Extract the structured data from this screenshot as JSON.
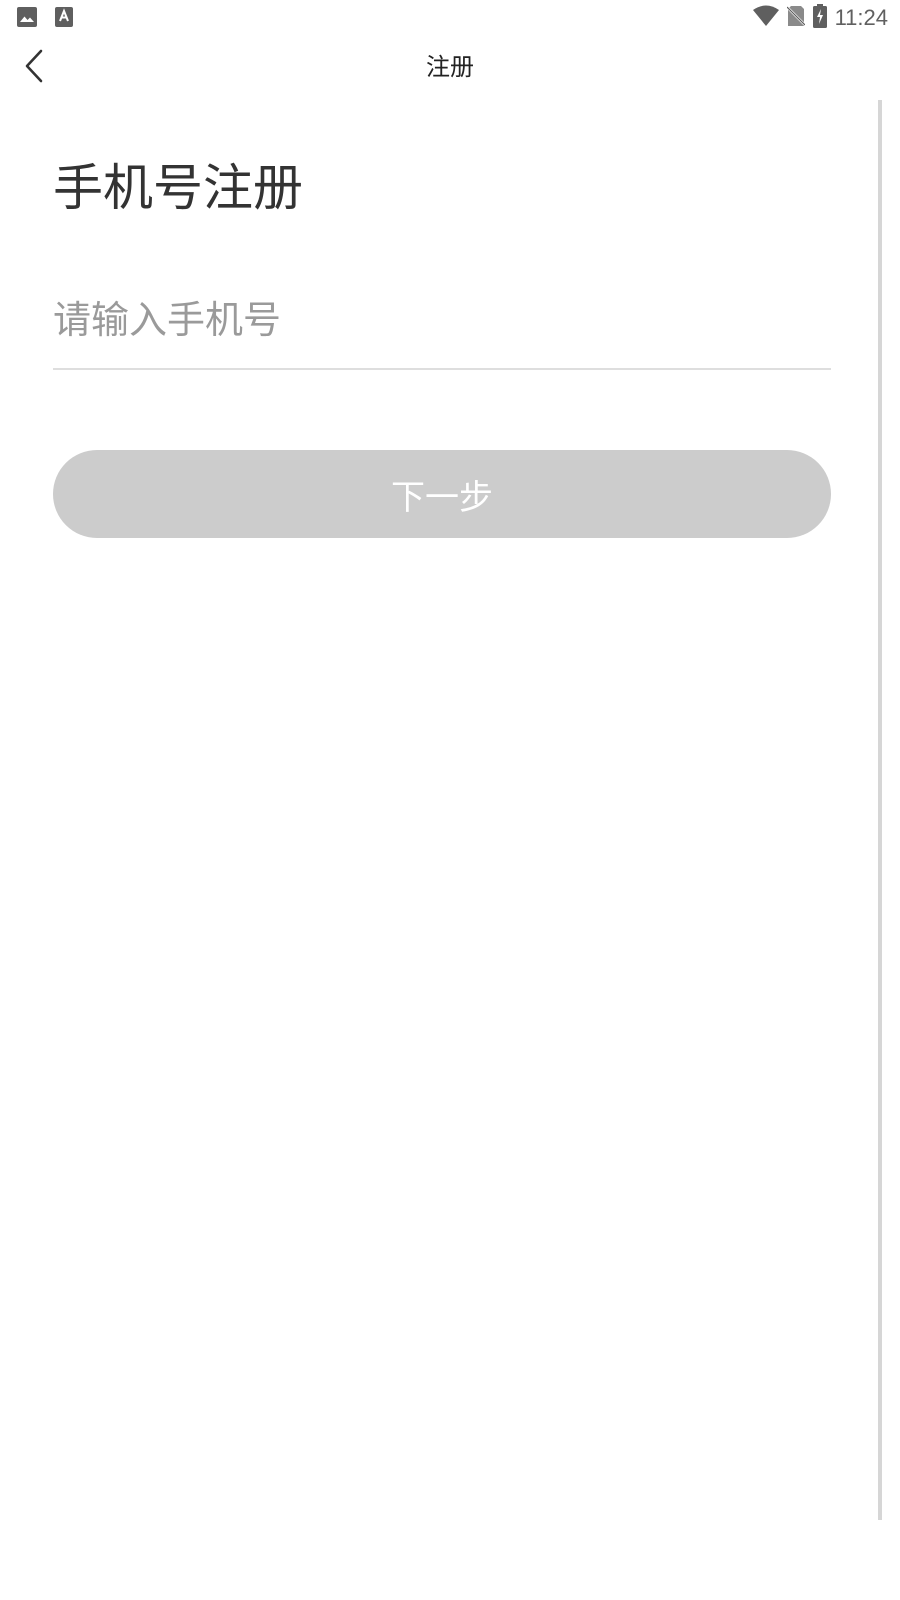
{
  "status_bar": {
    "time": "11:24",
    "left_icons": [
      "gallery-icon",
      "keyboard-a-icon"
    ],
    "right_icons": [
      "wifi-icon",
      "no-sim-icon",
      "battery-charging-icon"
    ]
  },
  "header": {
    "title": "注册",
    "back_icon": "chevron-left-icon"
  },
  "main": {
    "heading": "手机号注册",
    "phone_input": {
      "value": "",
      "placeholder": "请输入手机号"
    },
    "next_button_label": "下一步"
  },
  "colors": {
    "button_disabled": "#cccccc",
    "text_primary": "#333333",
    "placeholder": "#9a9a9a",
    "divider": "#dedede"
  }
}
